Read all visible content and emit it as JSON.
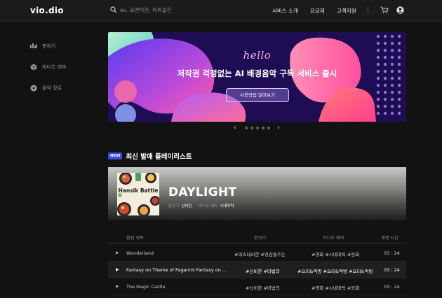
{
  "header": {
    "logo": "vio.dio",
    "search_placeholder": "ex. 로맨틱한, 파워풀한",
    "nav": [
      "서비스 소개",
      "요금제",
      "고객지원"
    ]
  },
  "sidebar": {
    "items": [
      {
        "label": "분위기",
        "icon": "mood-icon"
      },
      {
        "label": "비디오 테마",
        "icon": "cube-icon"
      },
      {
        "label": "음악 장르",
        "icon": "disc-icon"
      }
    ]
  },
  "banner": {
    "hello": "hello",
    "title": "저작권 걱정없는 AI 배경음악 구독 서비스 출시",
    "button": "사용방법 알아보기",
    "pager_total": 5,
    "pager_active": 0
  },
  "section": {
    "badge": "NEW",
    "title": "최신 발매 플레이리스트"
  },
  "playlist": {
    "cover_title": "Hansik Battle",
    "title": "DAYLIGHT",
    "mood_label": "분위기",
    "mood_value": "신비한",
    "theme_label": "비디오 테마",
    "theme_value": "시네마틱"
  },
  "table": {
    "headers": [
      "음원 제목",
      "분위기",
      "비디오 테마",
      "재생 시간"
    ],
    "rows": [
      {
        "title": "Wonderland",
        "mood": "#미스테리한 #엉감을주는",
        "theme": "#영화 #시네마틱 #동화",
        "time": "03 : 24"
      },
      {
        "title": "Fantasy on Theme of Paganini Fantasy on ...",
        "mood": "#신비한 #마법의",
        "theme": "#요리&먹방 #요리&먹방 #요리&먹방",
        "time": "03 : 24"
      },
      {
        "title": "The Magic Castle",
        "mood": "#신비한 #마법의",
        "theme": "#영화 #시네마틱 #동화",
        "time": "03 : 24"
      }
    ]
  },
  "colors": {
    "background": "#121212",
    "header": "#1b1b1b",
    "banner": "#1e0d55",
    "badge": "#3a4bd8"
  }
}
